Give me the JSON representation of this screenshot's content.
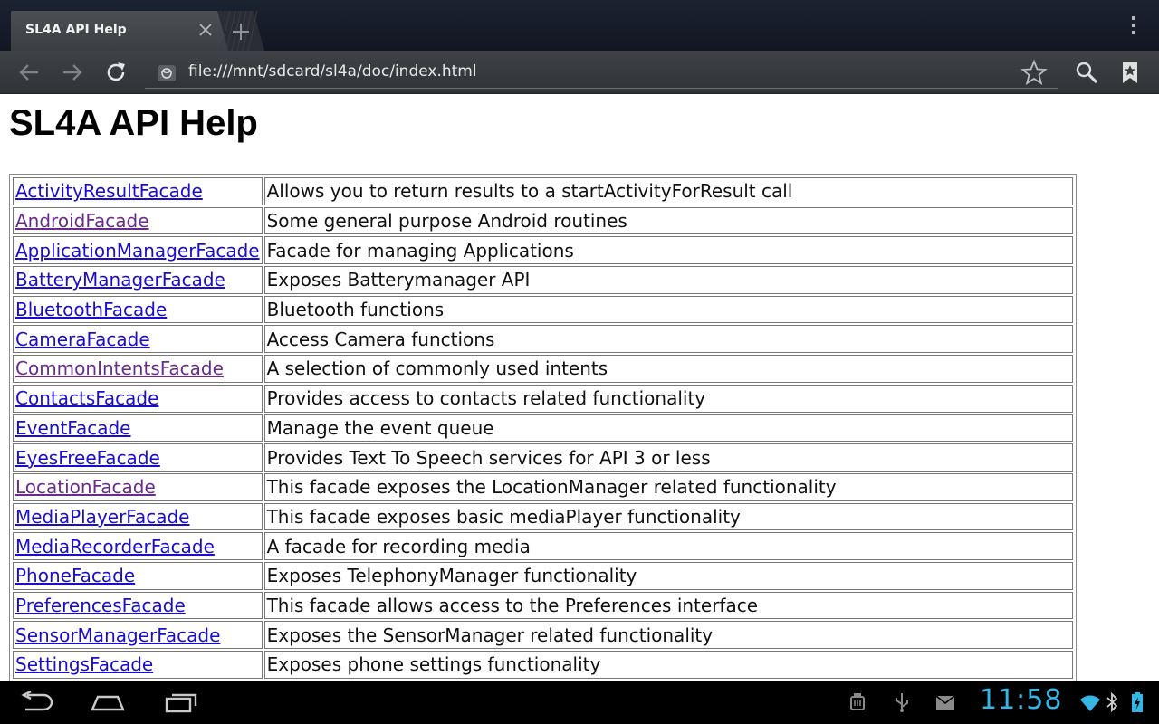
{
  "tab": {
    "title": "SL4A API Help"
  },
  "address": {
    "url": "file:///mnt/sdcard/sl4a/doc/index.html"
  },
  "page": {
    "heading": "SL4A API Help"
  },
  "rows": [
    {
      "name": "ActivityResultFacade",
      "desc": "Allows you to return results to a startActivityForResult call",
      "visited": false
    },
    {
      "name": "AndroidFacade",
      "desc": "Some general purpose Android routines",
      "visited": true
    },
    {
      "name": "ApplicationManagerFacade",
      "desc": "Facade for managing Applications",
      "visited": false
    },
    {
      "name": "BatteryManagerFacade",
      "desc": "Exposes Batterymanager API",
      "visited": false
    },
    {
      "name": "BluetoothFacade",
      "desc": "Bluetooth functions",
      "visited": false
    },
    {
      "name": "CameraFacade",
      "desc": "Access Camera functions",
      "visited": false
    },
    {
      "name": "CommonIntentsFacade",
      "desc": "A selection of commonly used intents",
      "visited": true
    },
    {
      "name": "ContactsFacade",
      "desc": "Provides access to contacts related functionality",
      "visited": false
    },
    {
      "name": "EventFacade",
      "desc": "Manage the event queue",
      "visited": false
    },
    {
      "name": "EyesFreeFacade",
      "desc": "Provides Text To Speech services for API 3 or less",
      "visited": false
    },
    {
      "name": "LocationFacade",
      "desc": "This facade exposes the LocationManager related functionality",
      "visited": true
    },
    {
      "name": "MediaPlayerFacade",
      "desc": "This facade exposes basic mediaPlayer functionality",
      "visited": false
    },
    {
      "name": "MediaRecorderFacade",
      "desc": "A facade for recording media",
      "visited": false
    },
    {
      "name": "PhoneFacade",
      "desc": "Exposes TelephonyManager functionality",
      "visited": false
    },
    {
      "name": "PreferencesFacade",
      "desc": "This facade allows access to the Preferences interface",
      "visited": false
    },
    {
      "name": "SensorManagerFacade",
      "desc": "Exposes the SensorManager related functionality",
      "visited": false
    },
    {
      "name": "SettingsFacade",
      "desc": "Exposes phone settings functionality",
      "visited": false
    }
  ],
  "status": {
    "clock": "11:58"
  },
  "colors": {
    "link": "#1a0dce",
    "visited": "#6a2c8a",
    "clock": "#35b7e6"
  }
}
